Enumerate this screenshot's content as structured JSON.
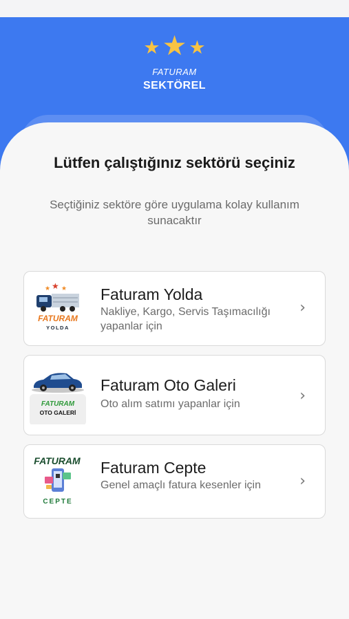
{
  "header": {
    "brand_small": "FATURAM",
    "brand_big": "SEKTÖREL",
    "star_color": "#f8c343",
    "background": "#3d79f0"
  },
  "main": {
    "title": "Lütfen çalıştığınız sektörü seçiniz",
    "subtitle": "Seçtiğiniz sektöre göre uygulama kolay kullanım sunacaktır"
  },
  "sectors": [
    {
      "name": "Faturam Yolda",
      "description": "Nakliye, Kargo, Servis Taşımacılığı yapanlar için",
      "logo_text_top": "FATURAM",
      "logo_text_bottom": "YOLDA",
      "icon": "truck-icon"
    },
    {
      "name": "Faturam Oto Galeri",
      "description": "Oto alım satımı yapanlar için",
      "logo_text_top": "FATURAM",
      "logo_text_bottom": "OTO GALERİ",
      "icon": "car-icon"
    },
    {
      "name": "Faturam Cepte",
      "description": "Genel amaçlı fatura kesenler için",
      "logo_text_top": "FATURAM",
      "logo_text_bottom": "CEPTE",
      "icon": "phone-invoice-icon"
    }
  ]
}
